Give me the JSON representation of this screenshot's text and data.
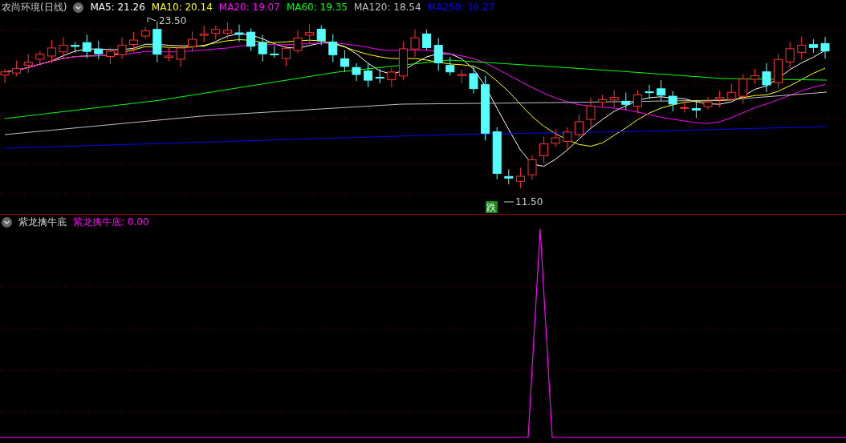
{
  "main_pane": {
    "title": "农尚环境(日线)",
    "legend": [
      {
        "label": "MA5: 21.26",
        "color": "#ffffff"
      },
      {
        "label": "MA10: 20.14",
        "color": "#ffff00"
      },
      {
        "label": "MA20: 19.07",
        "color": "#ff00ff"
      },
      {
        "label": "MA60: 19.35",
        "color": "#00ff00"
      },
      {
        "label": "MA120: 18.54",
        "color": "#c0c0c0"
      },
      {
        "label": "MA250: 16.27",
        "color": "#0000ff"
      }
    ],
    "high_label": "23.50",
    "low_label": "11.50",
    "signal_badge": "跌"
  },
  "indicator_pane": {
    "title": "紫龙擒牛底",
    "legend": [
      {
        "label": "紫龙擒牛底: 0.00",
        "color": "#ff00ff"
      }
    ]
  }
}
